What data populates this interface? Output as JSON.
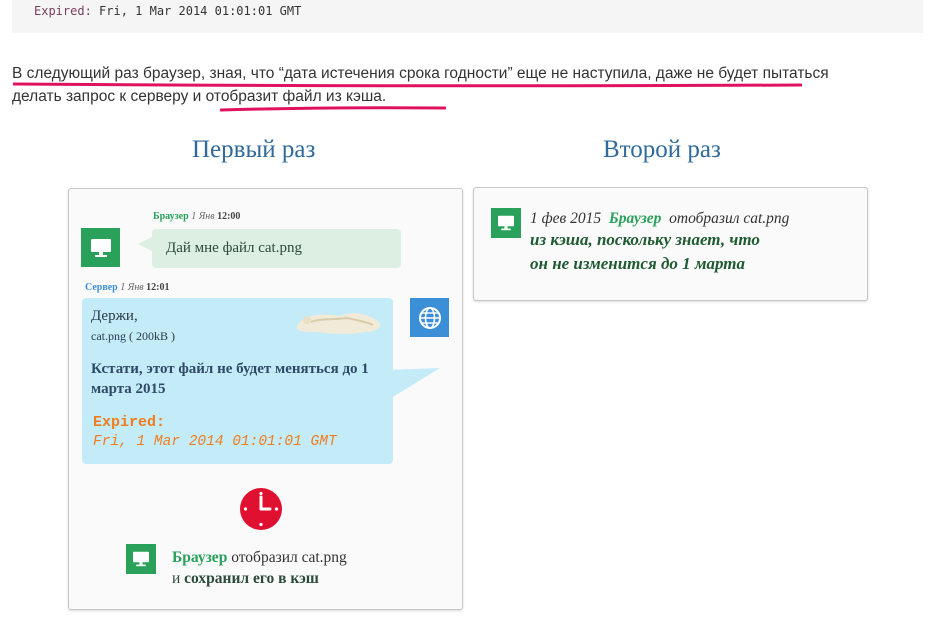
{
  "code": {
    "keyword": "Expired:",
    "value": "Fri, 1 Mar 2014 01:01:01 GMT"
  },
  "paragraph": {
    "line1": "В следующий раз браузер, зная, что “дата истечения срока годности” еще не наступила, даже не будет пытаться",
    "line2_plain": "делать запрос к серверу и ",
    "line2_highlight": "отобразит файл из кэша."
  },
  "columns": {
    "first_title": "Первый раз",
    "second_title": "Второй раз"
  },
  "first": {
    "browser_meta": {
      "who": "Браузер",
      "date": "1 Янв",
      "time": "12:00"
    },
    "browser_message": "Дай мне файл cat.png",
    "server_meta": {
      "who": "Сервер",
      "date": "1 Янв",
      "time": "12:01"
    },
    "server_reply": {
      "greeting": "Держи,",
      "file_name": "cat.png",
      "file_size": "( 200kB )",
      "note": "Кстати, этот файл не будет меняться до 1 марта 2015",
      "expired_label": "Expired:",
      "expired_value": "Fri, 1 Mar 2014 01:01:01 GMT"
    },
    "result": {
      "who": "Браузер",
      "line1_rest": "отобразил cat.png",
      "line2_prefix": "и",
      "line2_bold": "сохранил его в кэш"
    }
  },
  "second": {
    "date": "1 фев 2015",
    "who": "Браузер",
    "action": "отобразил cat.png",
    "line2": "из кэша, поскольку знает, что",
    "line3": "он не изменится до 1 марта"
  },
  "icons": {
    "computer": "computer-monitor-icon",
    "globe": "globe-icon",
    "clock": "clock-icon",
    "cat": "cat-image"
  },
  "colors": {
    "green": "#2aa15a",
    "blue": "#3b8fd6",
    "clock_red": "#e01030",
    "underline_pink": "#e0115f",
    "expired_orange": "#f07d1d",
    "title_blue": "#2f6a9a"
  }
}
